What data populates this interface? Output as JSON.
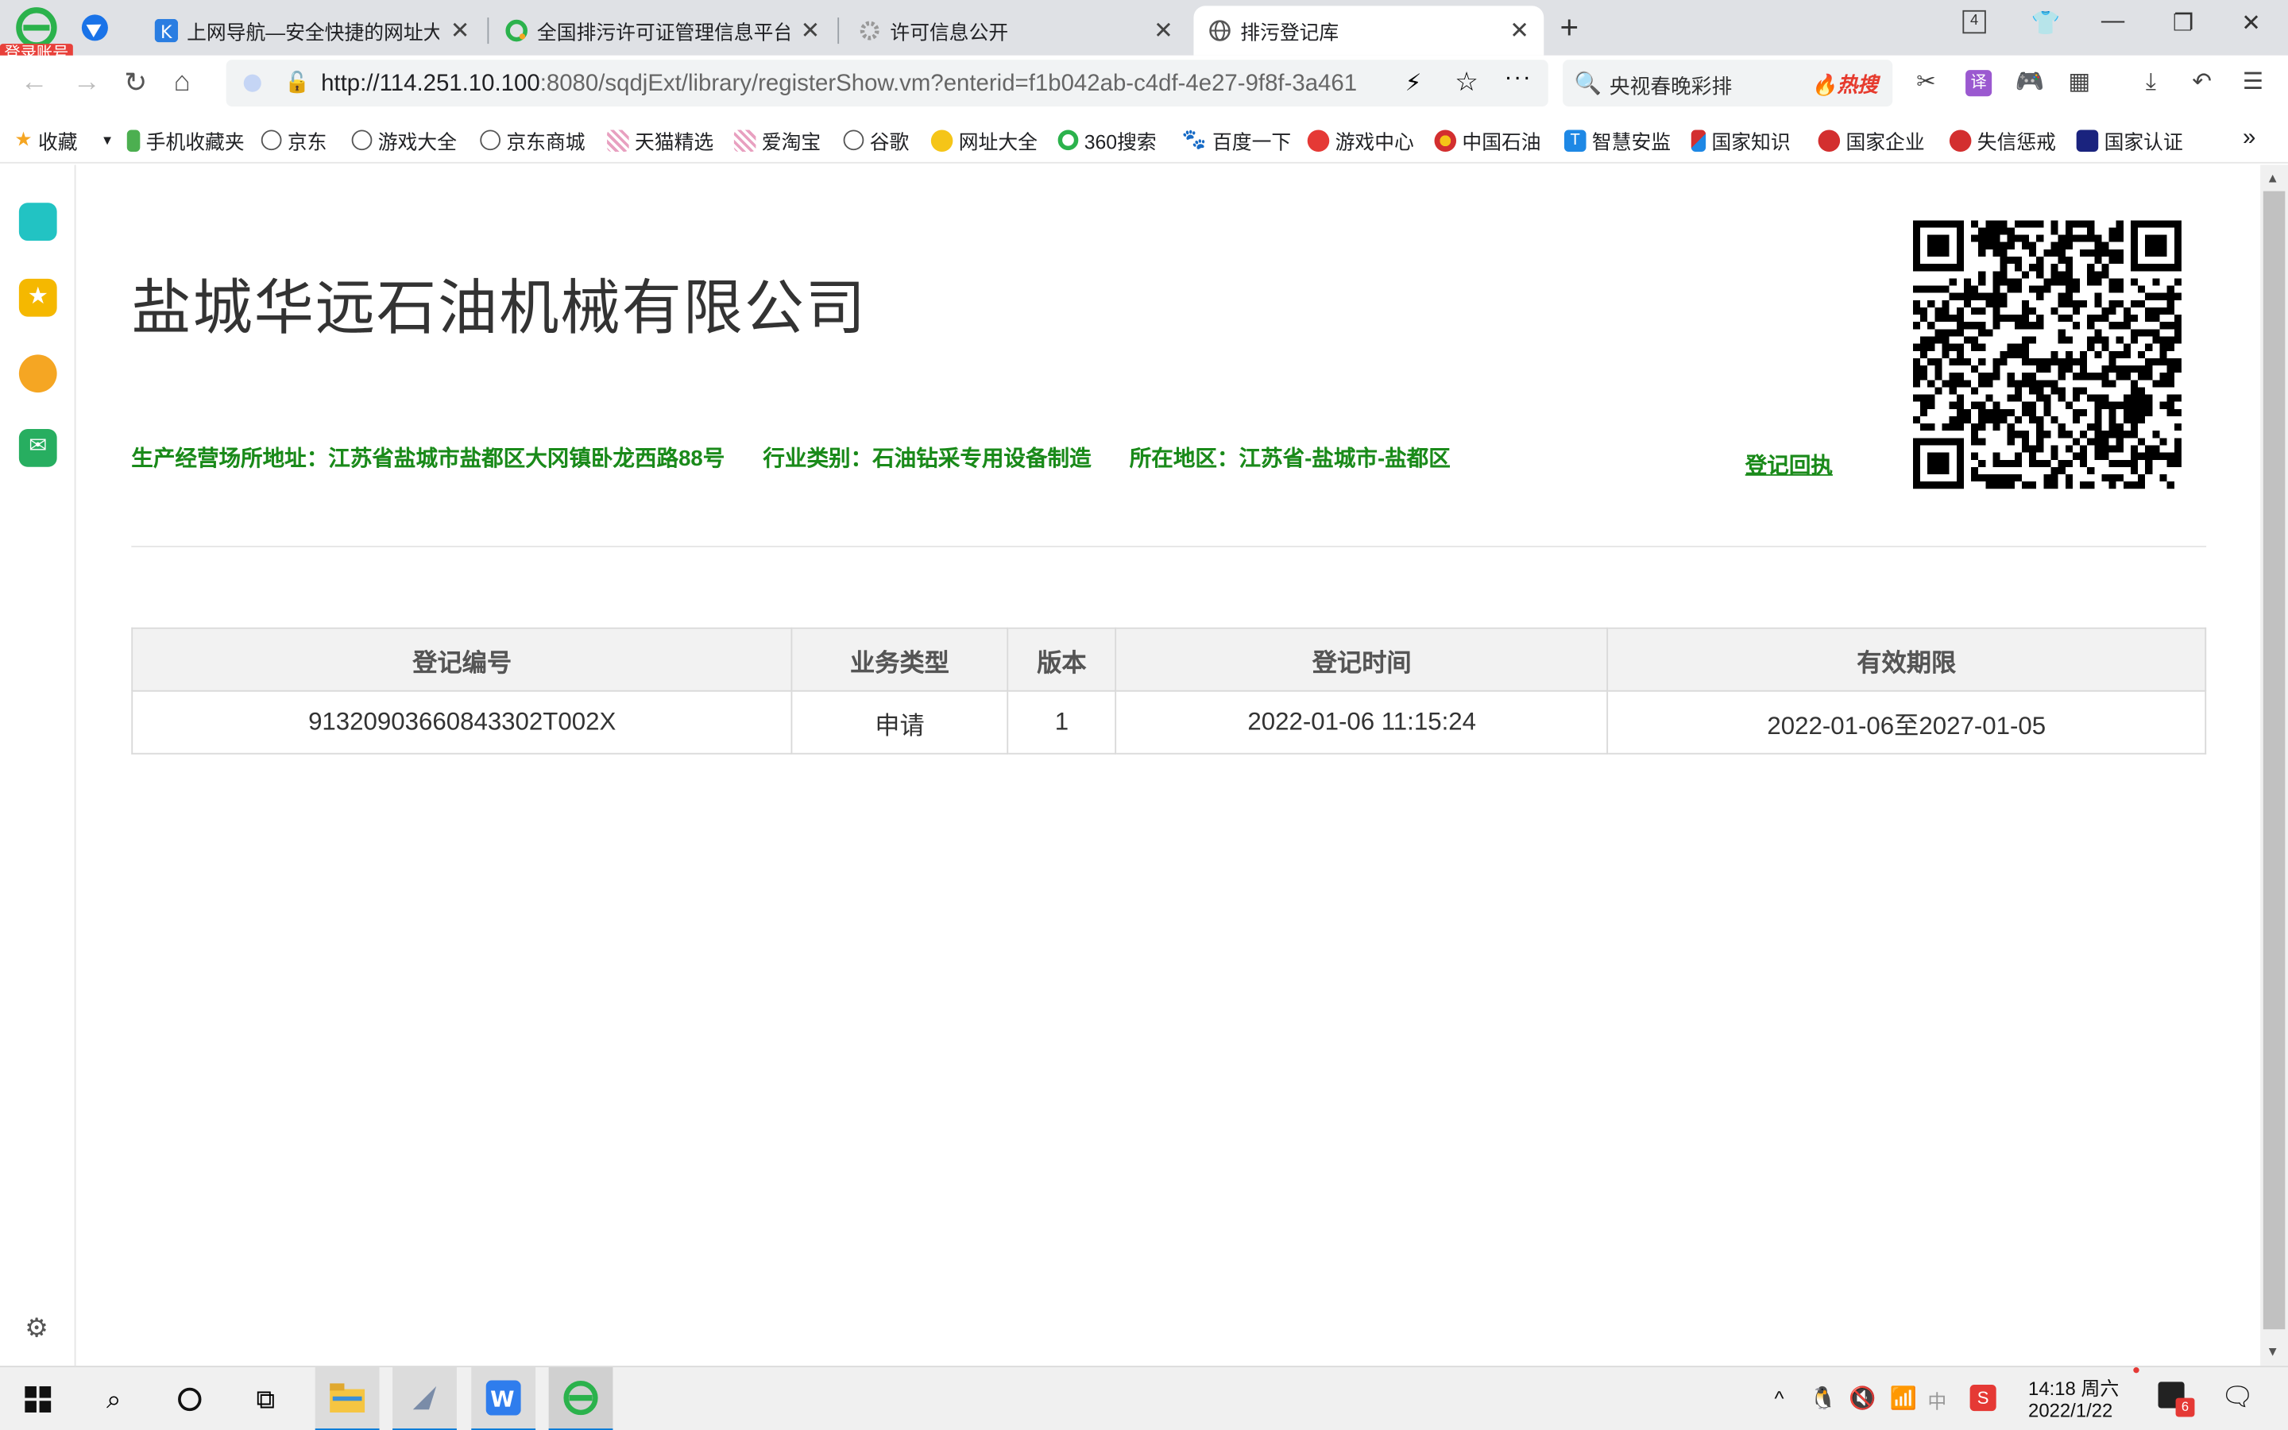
{
  "browser": {
    "login_badge": "登录账号",
    "tabs": [
      {
        "title": "上网导航—安全快捷的网址大全"
      },
      {
        "title": "全国排污许可证管理信息平台"
      },
      {
        "title": "许可信息公开"
      },
      {
        "title": "排污登记库"
      }
    ],
    "tab_count": "4",
    "url_host": "http://114.251.10.100",
    "url_rest": ":8080/sqdjExt/library/registerShow.vm?enterid=f1b042ab-c4df-4e27-9f8f-3a461",
    "search_query": "央视春晚彩排",
    "search_hot": "热搜",
    "bookmarks": [
      "收藏",
      "手机收藏夹",
      "京东",
      "游戏大全",
      "京东商城",
      "天猫精选",
      "爱淘宝",
      "谷歌",
      "网址大全",
      "360搜索",
      "百度一下",
      "游戏中心",
      "中国石油",
      "智慧安监",
      "国家知识",
      "国家企业",
      "失信惩戒",
      "国家认证"
    ]
  },
  "page": {
    "company_name": "盐城华远石油机械有限公司",
    "address": "生产经营场所地址：江苏省盐城市盐都区大冈镇卧龙西路88号",
    "industry": "行业类别：石油钻采专用设备制造",
    "region": "所在地区：江苏省-盐城市-盐都区",
    "receipt_link": "登记回执",
    "table": {
      "headers": [
        "登记编号",
        "业务类型",
        "版本",
        "登记时间",
        "有效期限"
      ],
      "rows": [
        [
          "91320903660843302T002X",
          "申请",
          "1",
          "2022-01-06 11:15:24",
          "2022-01-06至2027-01-05"
        ]
      ]
    }
  },
  "taskbar": {
    "time": "14:18 周六",
    "date": "2022/1/22",
    "ime": "中",
    "notif_count": "6"
  },
  "colors": {
    "accent_green": "#1a8a1a",
    "tab_strip": "#dfe1e5"
  }
}
